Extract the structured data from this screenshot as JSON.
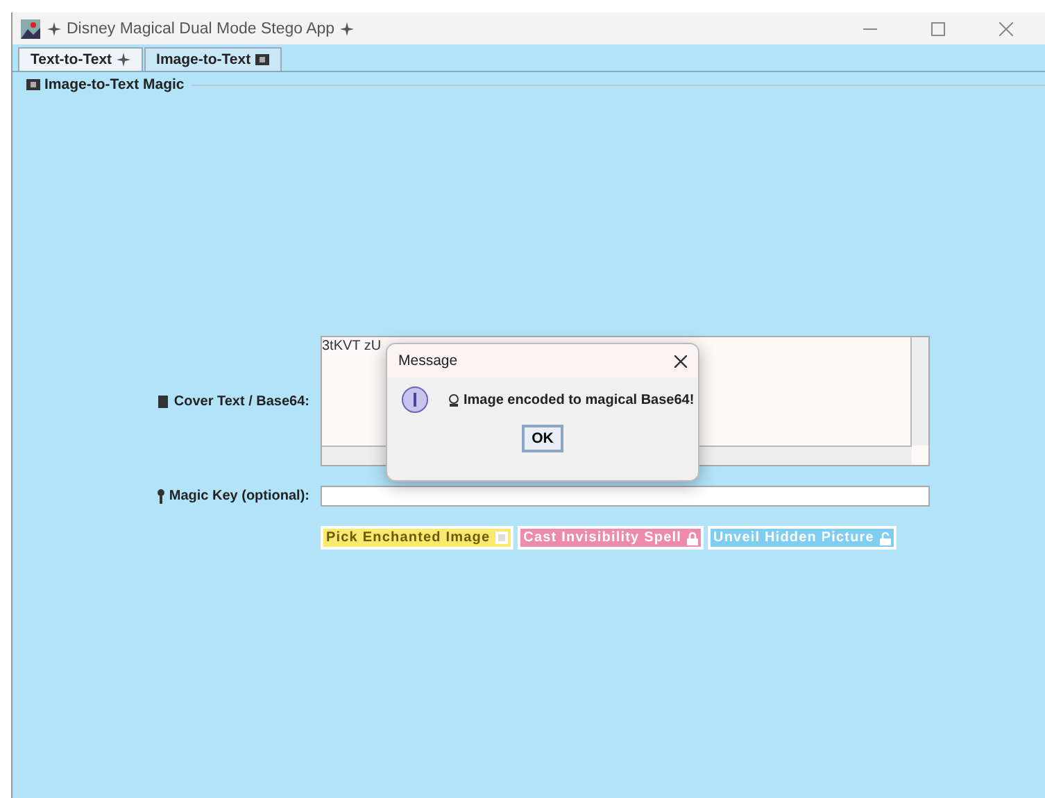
{
  "window": {
    "title": "Disney Magical Dual Mode Stego App"
  },
  "tabs": [
    {
      "label": "Text-to-Text",
      "selected": false
    },
    {
      "label": "Image-to-Text",
      "selected": true
    }
  ],
  "panel": {
    "title": "Image-to-Text Magic"
  },
  "cover_text": {
    "label": "Cover Text / Base64:",
    "value": "3tKVT zU"
  },
  "magic_key": {
    "label": "Magic Key (optional):"
  },
  "buttons": [
    {
      "label": "Pick Enchanted Image",
      "color": "#fbe96f"
    },
    {
      "label": "Cast Invisibility Spell",
      "color": "#ee8aaa"
    },
    {
      "label": "Unveil Hidden Picture",
      "color": "#7fcdf0"
    }
  ],
  "dialog": {
    "title": "Message",
    "message": "Image encoded to magical Base64!",
    "button": "OK"
  }
}
